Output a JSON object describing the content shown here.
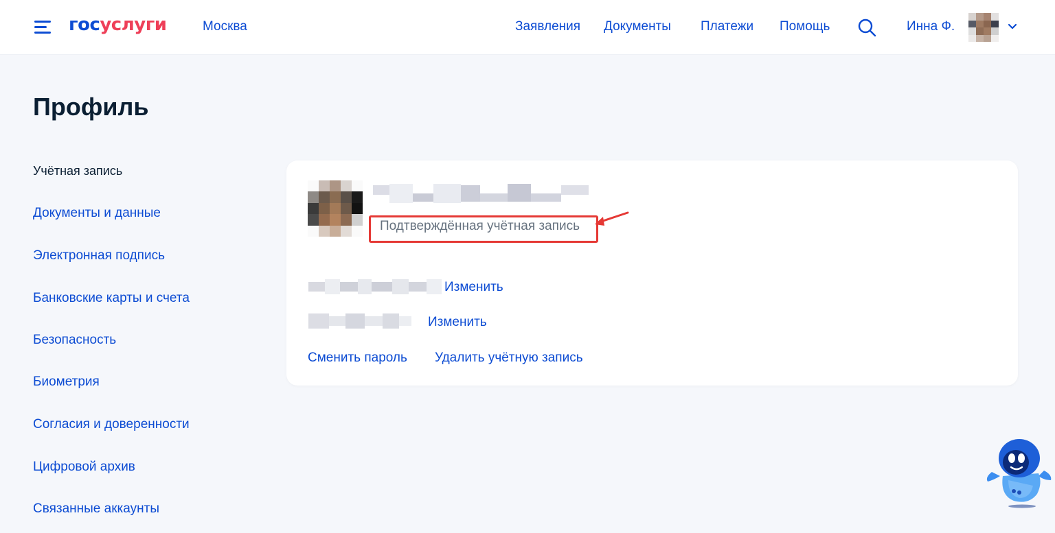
{
  "header": {
    "logo_part1": "гос",
    "logo_part2": "услуги",
    "city": "Москва",
    "nav": [
      "Заявления",
      "Документы",
      "Платежи",
      "Помощь"
    ],
    "user_name": "Инна Ф.",
    "icons": [
      "menu-icon",
      "search-icon",
      "chevron-down-icon"
    ]
  },
  "page": {
    "title": "Профиль"
  },
  "sidebar": {
    "items": [
      {
        "label": "Учётная запись",
        "active": true
      },
      {
        "label": "Документы и данные"
      },
      {
        "label": "Электронная подпись"
      },
      {
        "label": "Банковские карты и счета"
      },
      {
        "label": "Безопасность"
      },
      {
        "label": "Биометрия"
      },
      {
        "label": "Согласия и доверенности"
      },
      {
        "label": "Цифровой архив"
      },
      {
        "label": "Связанные аккаунты"
      }
    ]
  },
  "account_card": {
    "status": "Подтверждённая учётная запись",
    "contact_rows": [
      {
        "action": "Изменить"
      },
      {
        "action": "Изменить"
      }
    ],
    "change_password": "Сменить пароль",
    "delete_account": "Удалить учётную запись"
  },
  "colors": {
    "accent": "#0d4cd3",
    "brand_red": "#ee3f58",
    "highlight": "#e53935",
    "background": "#f5f7fb"
  }
}
